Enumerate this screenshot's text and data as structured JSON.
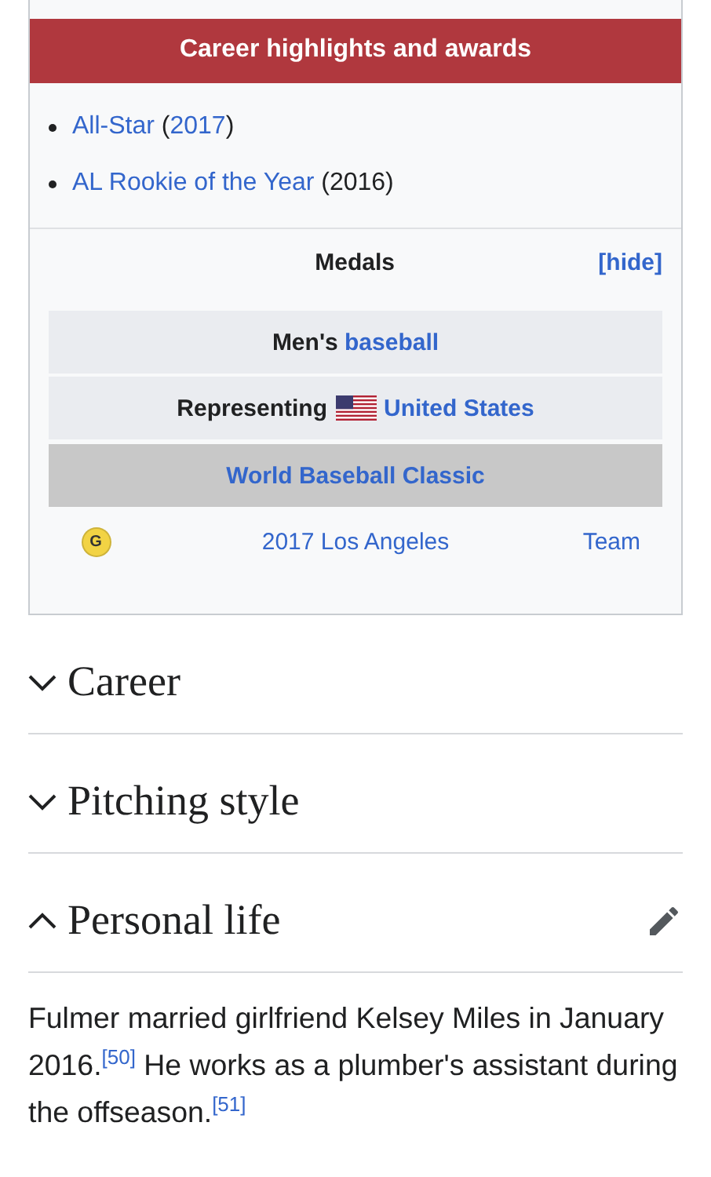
{
  "infobox": {
    "header": "Career highlights and awards",
    "awards": [
      {
        "parts": [
          {
            "text": "All-Star",
            "link": true
          },
          {
            "text": " (",
            "link": false
          },
          {
            "text": "2017",
            "link": true
          },
          {
            "text": ")",
            "link": false
          }
        ]
      },
      {
        "parts": [
          {
            "text": "AL Rookie of the Year",
            "link": true
          },
          {
            "text": " (2016)",
            "link": false
          }
        ]
      }
    ],
    "medals": {
      "title": "Medals",
      "toggle": "[hide]",
      "sport": {
        "label": "Men's",
        "link": "baseball"
      },
      "country": {
        "label": "Representing",
        "link": "United States"
      },
      "competition": "World Baseball Classic",
      "entries": [
        {
          "kind": "gold",
          "medal": "G",
          "event": "2017 Los Angeles",
          "category": "Team"
        }
      ]
    }
  },
  "sections": [
    {
      "title": "Career",
      "expanded": false,
      "editable": false
    },
    {
      "title": "Pitching style",
      "expanded": false,
      "editable": false
    },
    {
      "title": "Personal life",
      "expanded": true,
      "editable": true
    }
  ],
  "paragraph": "Fulmer married girlfriend Kelsey Miles in January 2016.$^{[50]}$ He works as a plumber's assistant during the offseason.$^{[51]}$"
}
